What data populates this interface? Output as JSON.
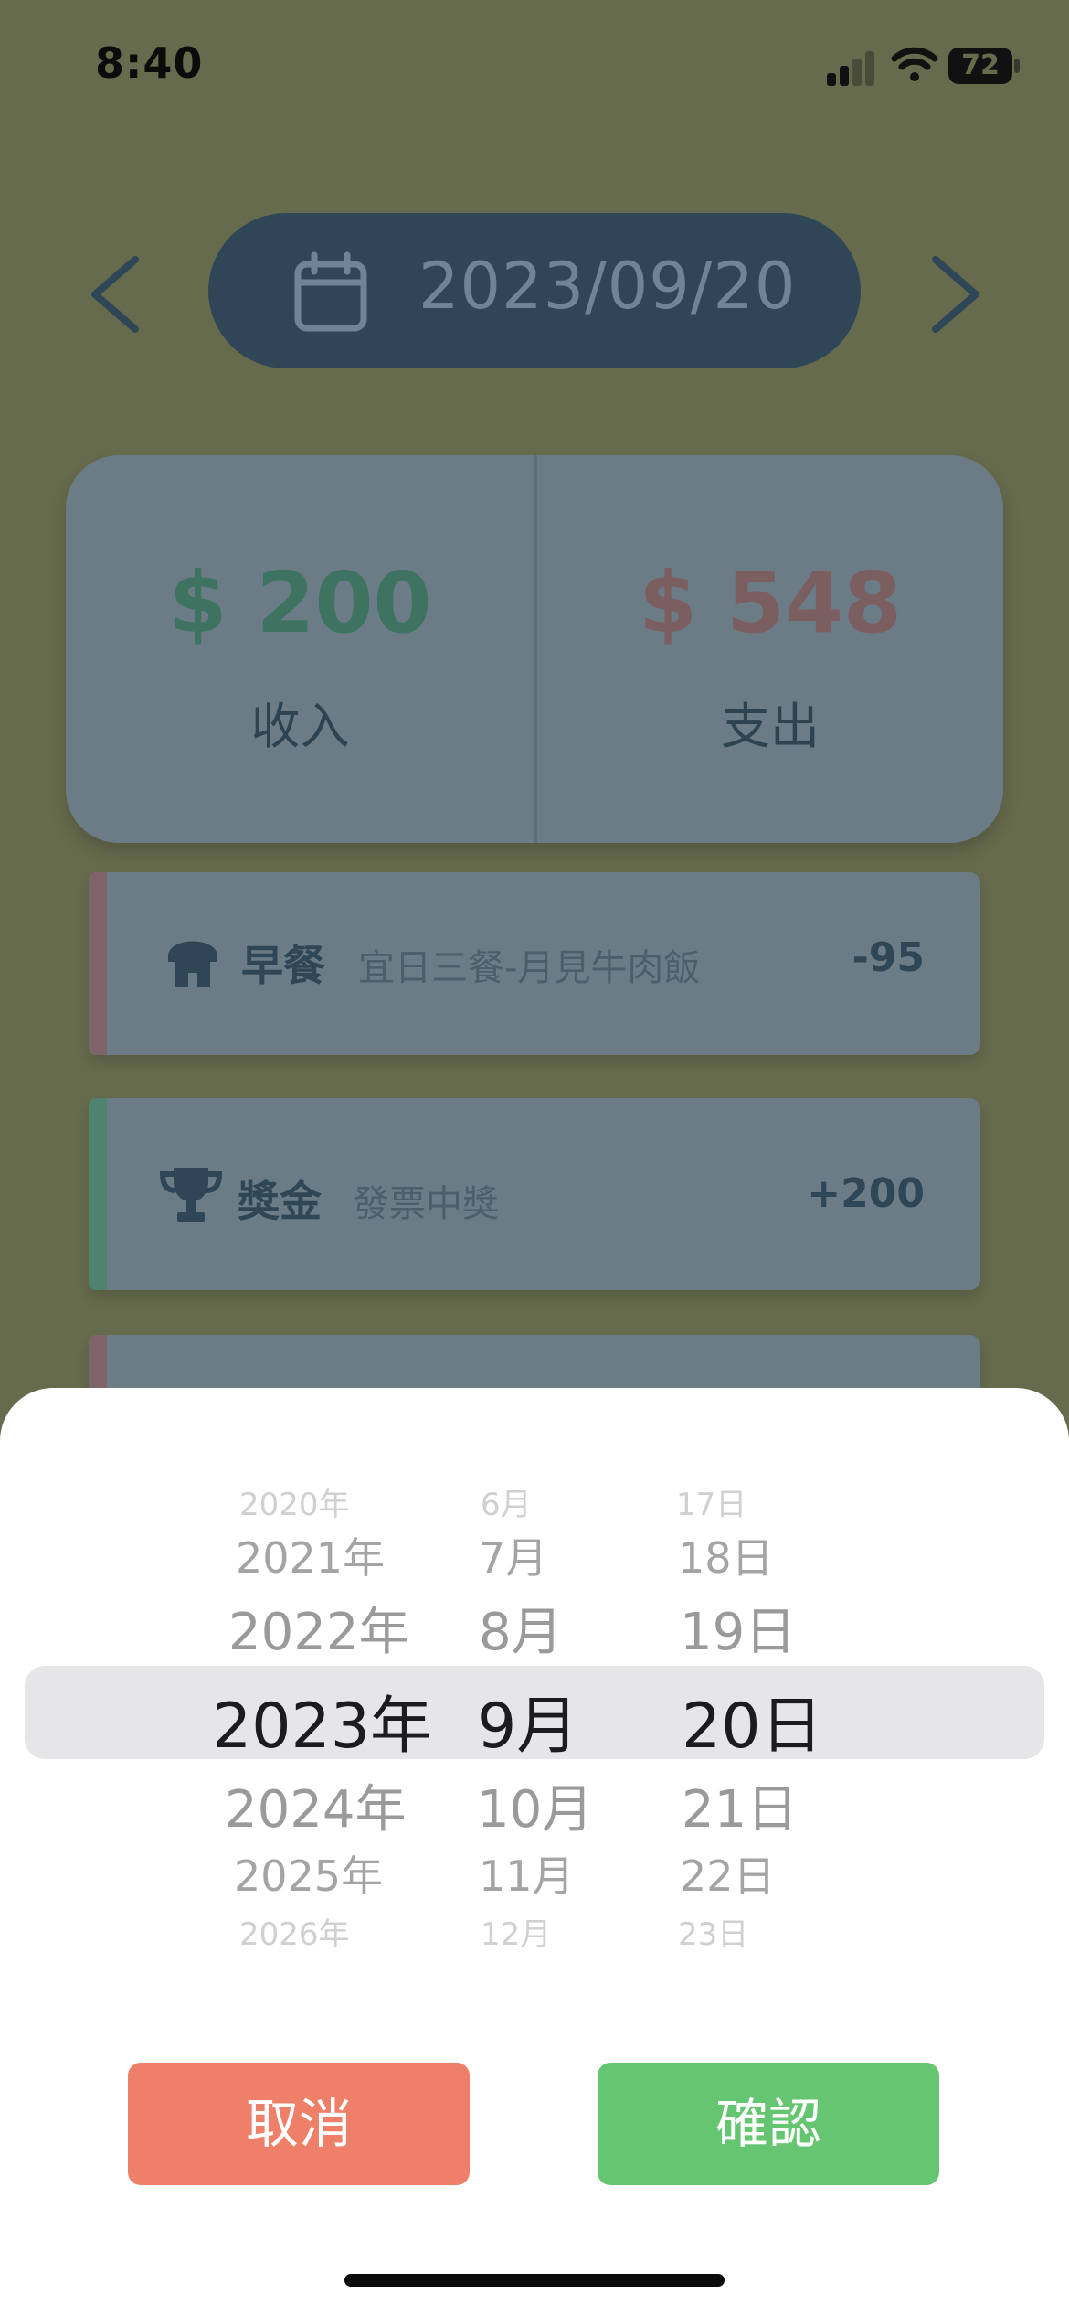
{
  "status_bar": {
    "time": "8:40",
    "battery": "72"
  },
  "header": {
    "date": "2023/09/20"
  },
  "summary": {
    "income_amount": "$ 200",
    "income_label": "收入",
    "expense_amount": "$ 548",
    "expense_label": "支出"
  },
  "records": [
    {
      "category": "早餐",
      "note": "宜日三餐-月見牛肉飯",
      "amount": "-95",
      "icon": "food-icon",
      "bar_color": "#7d6467"
    },
    {
      "category": "獎金",
      "note": "發票中獎",
      "amount": "+200",
      "icon": "trophy-icon",
      "bar_color": "#4f8370"
    }
  ],
  "picker": {
    "years": [
      "2020年",
      "2021年",
      "2022年",
      "2023年",
      "2024年",
      "2025年",
      "2026年"
    ],
    "months": [
      "6月",
      "7月",
      "8月",
      "9月",
      "10月",
      "11月",
      "12月"
    ],
    "days": [
      "17日",
      "18日",
      "19日",
      "20日",
      "21日",
      "22日",
      "23日"
    ],
    "selected": {
      "year": "2023年",
      "month": "9月",
      "day": "20日"
    }
  },
  "buttons": {
    "cancel": "取消",
    "confirm": "確認"
  },
  "colors": {
    "overlay_bg": "#676b4d",
    "pill": "#2f4656",
    "income": "#3e7361",
    "expense": "#7b5e60",
    "cancel": "#ee8069",
    "confirm": "#66c571"
  }
}
